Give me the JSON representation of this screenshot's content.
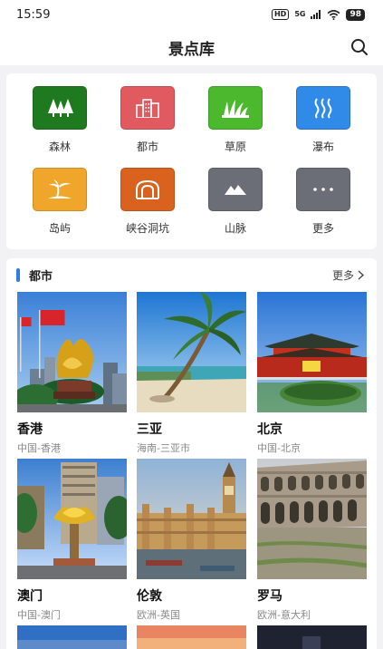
{
  "status": {
    "time": "15:59",
    "network": "HD",
    "signal": "5G",
    "battery": "98"
  },
  "header": {
    "title": "景点库",
    "search_icon": "search-icon"
  },
  "categories": [
    {
      "label": "森林",
      "icon": "forest-icon",
      "color": "#1f7a1f"
    },
    {
      "label": "都市",
      "icon": "city-icon",
      "color": "#e05a5f"
    },
    {
      "label": "草原",
      "icon": "grassland-icon",
      "color": "#4cb82e"
    },
    {
      "label": "瀑布",
      "icon": "waterfall-icon",
      "color": "#2f8ae8"
    },
    {
      "label": "岛屿",
      "icon": "island-icon",
      "color": "#f0a62a"
    },
    {
      "label": "峡谷洞坑",
      "icon": "canyon-icon",
      "color": "#d9621f"
    },
    {
      "label": "山脉",
      "icon": "mountain-icon",
      "color": "#6b6e76"
    },
    {
      "label": "更多",
      "icon": "more-icon",
      "color": "#6b6e76"
    }
  ],
  "section": {
    "title": "都市",
    "more": "更多"
  },
  "cities": [
    {
      "name": "香港",
      "region": "中国-香港"
    },
    {
      "name": "三亚",
      "region": "海南-三亚市"
    },
    {
      "name": "北京",
      "region": "中国-北京"
    },
    {
      "name": "澳门",
      "region": "中国-澳门"
    },
    {
      "name": "伦敦",
      "region": "欧洲-英国"
    },
    {
      "name": "罗马",
      "region": "欧洲-意大利"
    }
  ]
}
